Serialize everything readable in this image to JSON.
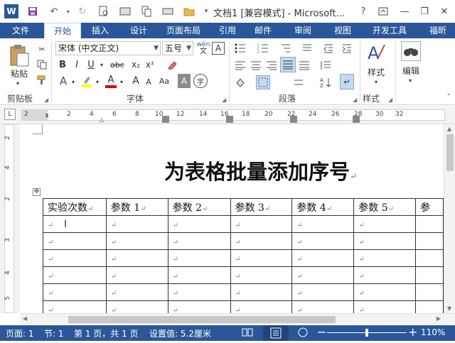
{
  "titlebar": {
    "app_logo": "W",
    "title": "文档1 [兼容模式] - Microsoft...",
    "help": "?",
    "icons": [
      "word-logo-icon",
      "save-icon",
      "undo-icon",
      "redo-icon",
      "print-preview-icon",
      "paste-special-icon",
      "copy-icon",
      "shortcut-icon",
      "folder-icon",
      "customize-icon"
    ]
  },
  "tabs": [
    "文件",
    "开始",
    "插入",
    "设计",
    "页面布局",
    "引用",
    "邮件",
    "审阅",
    "视图",
    "开发工具",
    "福昕"
  ],
  "ribbon": {
    "clipboard": {
      "paste_label": "粘贴",
      "group_label": "剪贴板"
    },
    "font": {
      "font_name": "宋体 (中文正文)",
      "font_size": "五号",
      "wen_glyph": "wén",
      "wen_char": "文",
      "a_box": "A",
      "bold": "B",
      "italic": "I",
      "underline": "U",
      "strike": "abc",
      "subscript": "x₂",
      "superscript": "x²",
      "font_color_a": "A",
      "grow_a": "A",
      "shrink_a": "A",
      "aa": "Aa",
      "charshade_a": "A",
      "circle_char": "字",
      "group_label": "字体"
    },
    "paragraph": {
      "group_label": "段落"
    },
    "styles": {
      "label": "样式",
      "group_label": "样式"
    },
    "editing": {
      "label": "编辑"
    }
  },
  "ruler": {
    "h_numbers": [
      "2",
      "2",
      "4",
      "6",
      "8",
      "10",
      "12",
      "14",
      "16",
      "18",
      "20",
      "22",
      "24",
      "26",
      "28",
      "30",
      "32"
    ],
    "v_numbers": [
      "2",
      "4",
      "2",
      "3",
      "4",
      "5"
    ]
  },
  "document": {
    "title": "为表格批量添加序号",
    "paragraph_mark": "↵",
    "table": {
      "header": [
        "实验次数",
        "参数 1",
        "参数 2",
        "参数 3",
        "参数 4",
        "参数 5",
        "参"
      ],
      "empty_rows": 6
    }
  },
  "statusbar": {
    "page": "页面: 1",
    "section": "节: 1",
    "pages": "第 1 页，共 1 页",
    "setting": "设置值: 5.2厘米",
    "zoom_out": "−",
    "zoom_in": "+",
    "zoom": "110%",
    "zoom_level": 0.5
  },
  "colors": {
    "accent": "#2b579a",
    "white": "#ffffff"
  }
}
